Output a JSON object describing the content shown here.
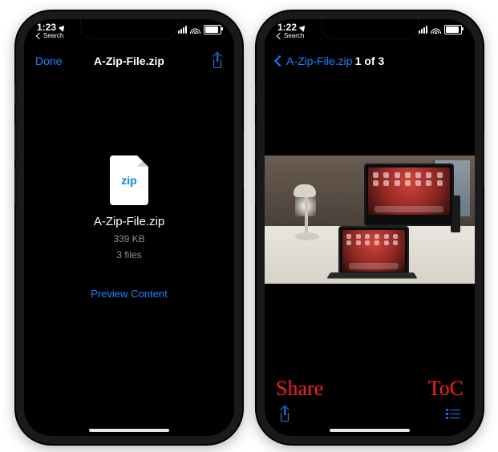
{
  "left": {
    "status": {
      "time": "1:23",
      "back_label": "Search"
    },
    "nav": {
      "done": "Done",
      "title": "A-Zip-File.zip"
    },
    "file": {
      "icon_label": "zip",
      "name": "A-Zip-File.zip",
      "size": "339 KB",
      "count": "3 files",
      "preview_label": "Preview Content"
    }
  },
  "right": {
    "status": {
      "time": "1:22",
      "back_label": "Search"
    },
    "nav": {
      "back_title": "A-Zip-File.zip",
      "counter": "1 of 3"
    },
    "annotations": {
      "share": "Share",
      "toc": "ToC"
    }
  },
  "colors": {
    "ios_blue": "#0a84ff",
    "accent_red": "#ff1a1a"
  }
}
